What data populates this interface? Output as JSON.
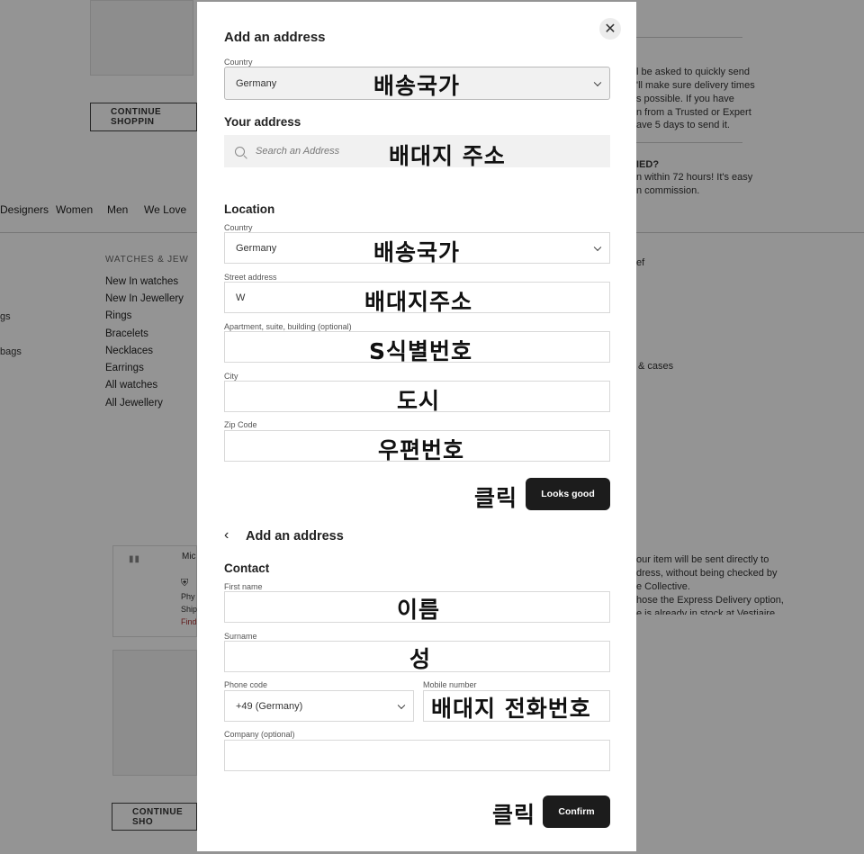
{
  "background": {
    "continue_shopping_1": "CONTINUE SHOPPIN",
    "continue_shopping_2": "CONTINUE SHO",
    "nav": [
      "Designers",
      "Women",
      "Men",
      "We Love"
    ],
    "menu_header": "WATCHES & JEW",
    "menu_items": [
      "New In watches",
      "New In Jewellery",
      "Rings",
      "Bracelets",
      "Necklaces",
      "Earrings",
      "All watches",
      "All Jewellery"
    ],
    "left_items": [
      "gs",
      "bags"
    ],
    "right_text_1": [
      "l be asked to quickly send",
      "'ll make sure delivery times",
      "s possible. If you have",
      "n from a Trusted or Expert",
      "ave 5 days to send it."
    ],
    "right_heading": "IED?",
    "right_text_2": [
      "n within 72 hours! It's easy",
      "n commission."
    ],
    "right_items": [
      "ef",
      "& cases"
    ],
    "right_text_3": [
      "our item will be sent directly to",
      "dress, without being checked by",
      "e Collective.",
      "hose the Express Delivery option,",
      "e is already in stock at Vestiaire"
    ],
    "product_fragments": [
      "Mic",
      "Phy",
      "Ship",
      "Find"
    ]
  },
  "modal": {
    "title": "Add an address",
    "country_label": "Country",
    "country_value": "Germany",
    "your_address": "Your address",
    "search_placeholder": "Search an Address",
    "location": "Location",
    "location_country_label": "Country",
    "location_country_value": "Germany",
    "street_label": "Street address",
    "street_value": "W",
    "apartment_label": "Apartment, suite, building (optional)",
    "city_label": "City",
    "zip_label": "Zip Code",
    "looks_good": "Looks good",
    "back_title": "Add an address",
    "contact": "Contact",
    "first_name_label": "First name",
    "surname_label": "Surname",
    "phone_code_label": "Phone code",
    "phone_code_value": "+49 (Germany)",
    "mobile_label": "Mobile number",
    "company_label": "Company (optional)",
    "confirm": "Confirm"
  },
  "annotations": {
    "country": "배송국가",
    "address": "배대지 주소",
    "country2": "배송국가",
    "street": "배대지주소",
    "apartment": "S식별번호",
    "city": "도시",
    "zip": "우편번호",
    "click1": "클릭",
    "first_name": "이름",
    "surname": "성",
    "mobile": "배대지 전화번호",
    "click2": "클릭"
  },
  "colors": {
    "dark_button": "#1c1c1c",
    "overlay": "rgba(0,0,0,0.42)"
  }
}
